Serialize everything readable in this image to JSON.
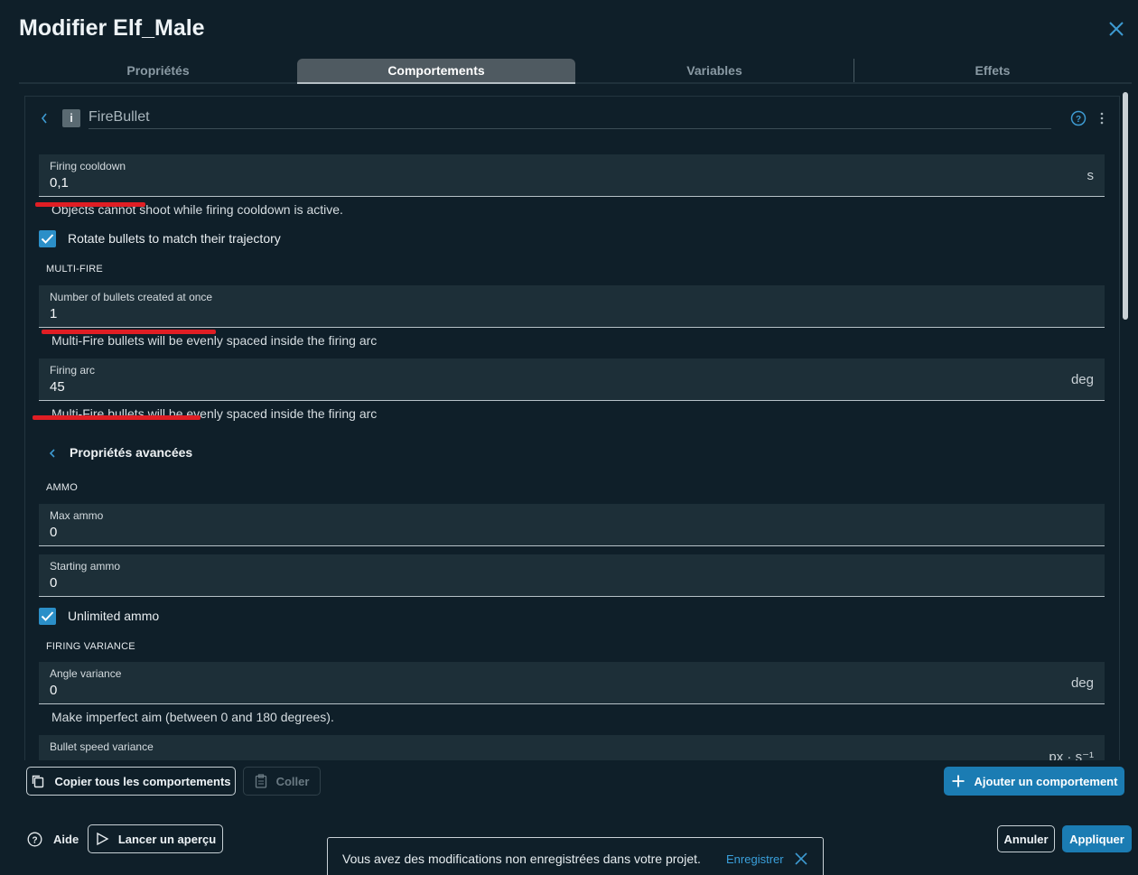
{
  "dialog": {
    "title": "Modifier Elf_Male"
  },
  "tabs": [
    {
      "label": "Propriétés"
    },
    {
      "label": "Comportements"
    },
    {
      "label": "Variables"
    },
    {
      "label": "Effets"
    }
  ],
  "behavior": {
    "icon_letter": "i",
    "name": "FireBullet"
  },
  "fields": {
    "firing_cooldown": {
      "label": "Firing cooldown",
      "value": "0,1",
      "unit": "s",
      "helper": "Objects cannot shoot while firing cooldown is active."
    },
    "rotate_bullets": {
      "label": "Rotate bullets to match their trajectory",
      "checked": true
    },
    "multi_fire_section": "MULTI-FIRE",
    "bullets_at_once": {
      "label": "Number of bullets created at once",
      "value": "1",
      "helper": "Multi-Fire bullets will be evenly spaced inside the firing arc"
    },
    "firing_arc": {
      "label": "Firing arc",
      "value": "45",
      "unit": "deg",
      "helper": "Multi-Fire bullets will be evenly spaced inside the firing arc"
    },
    "advanced_label": "Propriétés avancées",
    "ammo_section": "AMMO",
    "max_ammo": {
      "label": "Max ammo",
      "value": "0"
    },
    "starting_ammo": {
      "label": "Starting ammo",
      "value": "0"
    },
    "unlimited_ammo": {
      "label": "Unlimited ammo",
      "checked": true
    },
    "variance_section": "FIRING VARIANCE",
    "angle_variance": {
      "label": "Angle variance",
      "value": "0",
      "unit": "deg",
      "helper": "Make imperfect aim (between 0 and 180 degrees)."
    },
    "bullet_speed_variance": {
      "label": "Bullet speed variance",
      "unit": "px · s⁻¹"
    }
  },
  "actions": {
    "copy_all": "Copier tous les comportements",
    "paste": "Coller",
    "add_behavior": "Ajouter un comportement",
    "help": "Aide",
    "preview": "Lancer un aperçu",
    "cancel": "Annuler",
    "apply": "Appliquer"
  },
  "toast": {
    "message": "Vous avez des modifications non enregistrées dans votre projet.",
    "save": "Enregistrer"
  },
  "colors": {
    "background": "#0f1f29",
    "field_bg": "#1d2f38",
    "accent": "#1b7cb3",
    "annotation_red": "#e01e24"
  },
  "icons": [
    "close-icon",
    "back-chevron-icon",
    "behavior-type-icon",
    "help-circle-icon",
    "more-vertical-icon",
    "checkbox-check-icon",
    "copy-icon",
    "clipboard-icon",
    "plus-icon",
    "question-icon",
    "play-icon"
  ]
}
